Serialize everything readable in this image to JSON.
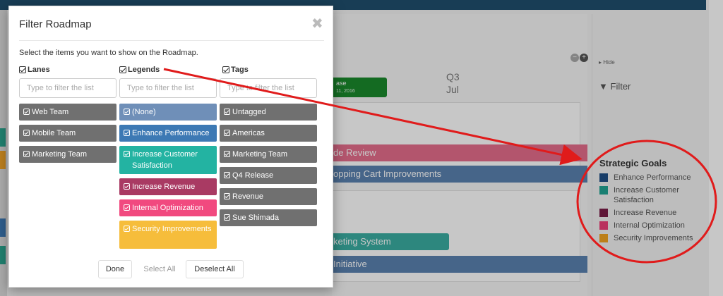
{
  "background": {
    "quarter": "Q3",
    "month": "Jul",
    "green_card": {
      "title": "ase",
      "date": "11, 2016"
    },
    "bars": {
      "pink": "de Review",
      "blue": "opping Cart Improvements",
      "teal": "keting System",
      "blue2": "Initiative"
    },
    "side_panel": {
      "hide": "Hide",
      "filter": "Filter",
      "goals_title": "Strategic Goals",
      "goals": [
        {
          "label": "Enhance Performance",
          "color": "#1f4f86"
        },
        {
          "label": "Increase Customer Satisfaction",
          "color": "#20a393"
        },
        {
          "label": "Increase Revenue",
          "color": "#7a1d47"
        },
        {
          "label": "Internal Optimization",
          "color": "#ee3f79"
        },
        {
          "label": "Security Improvements",
          "color": "#f1a320"
        }
      ]
    }
  },
  "modal": {
    "title": "Filter Roadmap",
    "close": "✖",
    "instructions": "Select the items you want to show on the Roadmap.",
    "columns": {
      "lanes": {
        "header": "Lanes",
        "placeholder": "Type to filter the list",
        "items": [
          "Web Team",
          "Mobile Team",
          "Marketing Team"
        ]
      },
      "legends": {
        "header": "Legends",
        "placeholder": "Type to filter the list",
        "items": [
          "(None)",
          "Enhance Performance",
          "Increase Customer Satisfaction",
          "Increase Revenue",
          "Internal Optimization",
          "Security Improvements"
        ]
      },
      "tags": {
        "header": "Tags",
        "placeholder": "Type to filter the list",
        "items": [
          "Untagged",
          "Americas",
          "Marketing Team",
          "Q4 Release",
          "Revenue",
          "Sue Shimada"
        ]
      }
    },
    "buttons": {
      "done": "Done",
      "select_all": "Select All",
      "deselect_all": "Deselect All"
    }
  },
  "colors": {
    "lane_chip": "#707070",
    "none_chip": "#6f8fb8",
    "enhance": "#3d79b4",
    "satisfaction": "#23b3a2",
    "revenue": "#a93a63",
    "internal": "#f1497f",
    "security": "#f6bd3b",
    "annotation": "#e01b1b"
  }
}
